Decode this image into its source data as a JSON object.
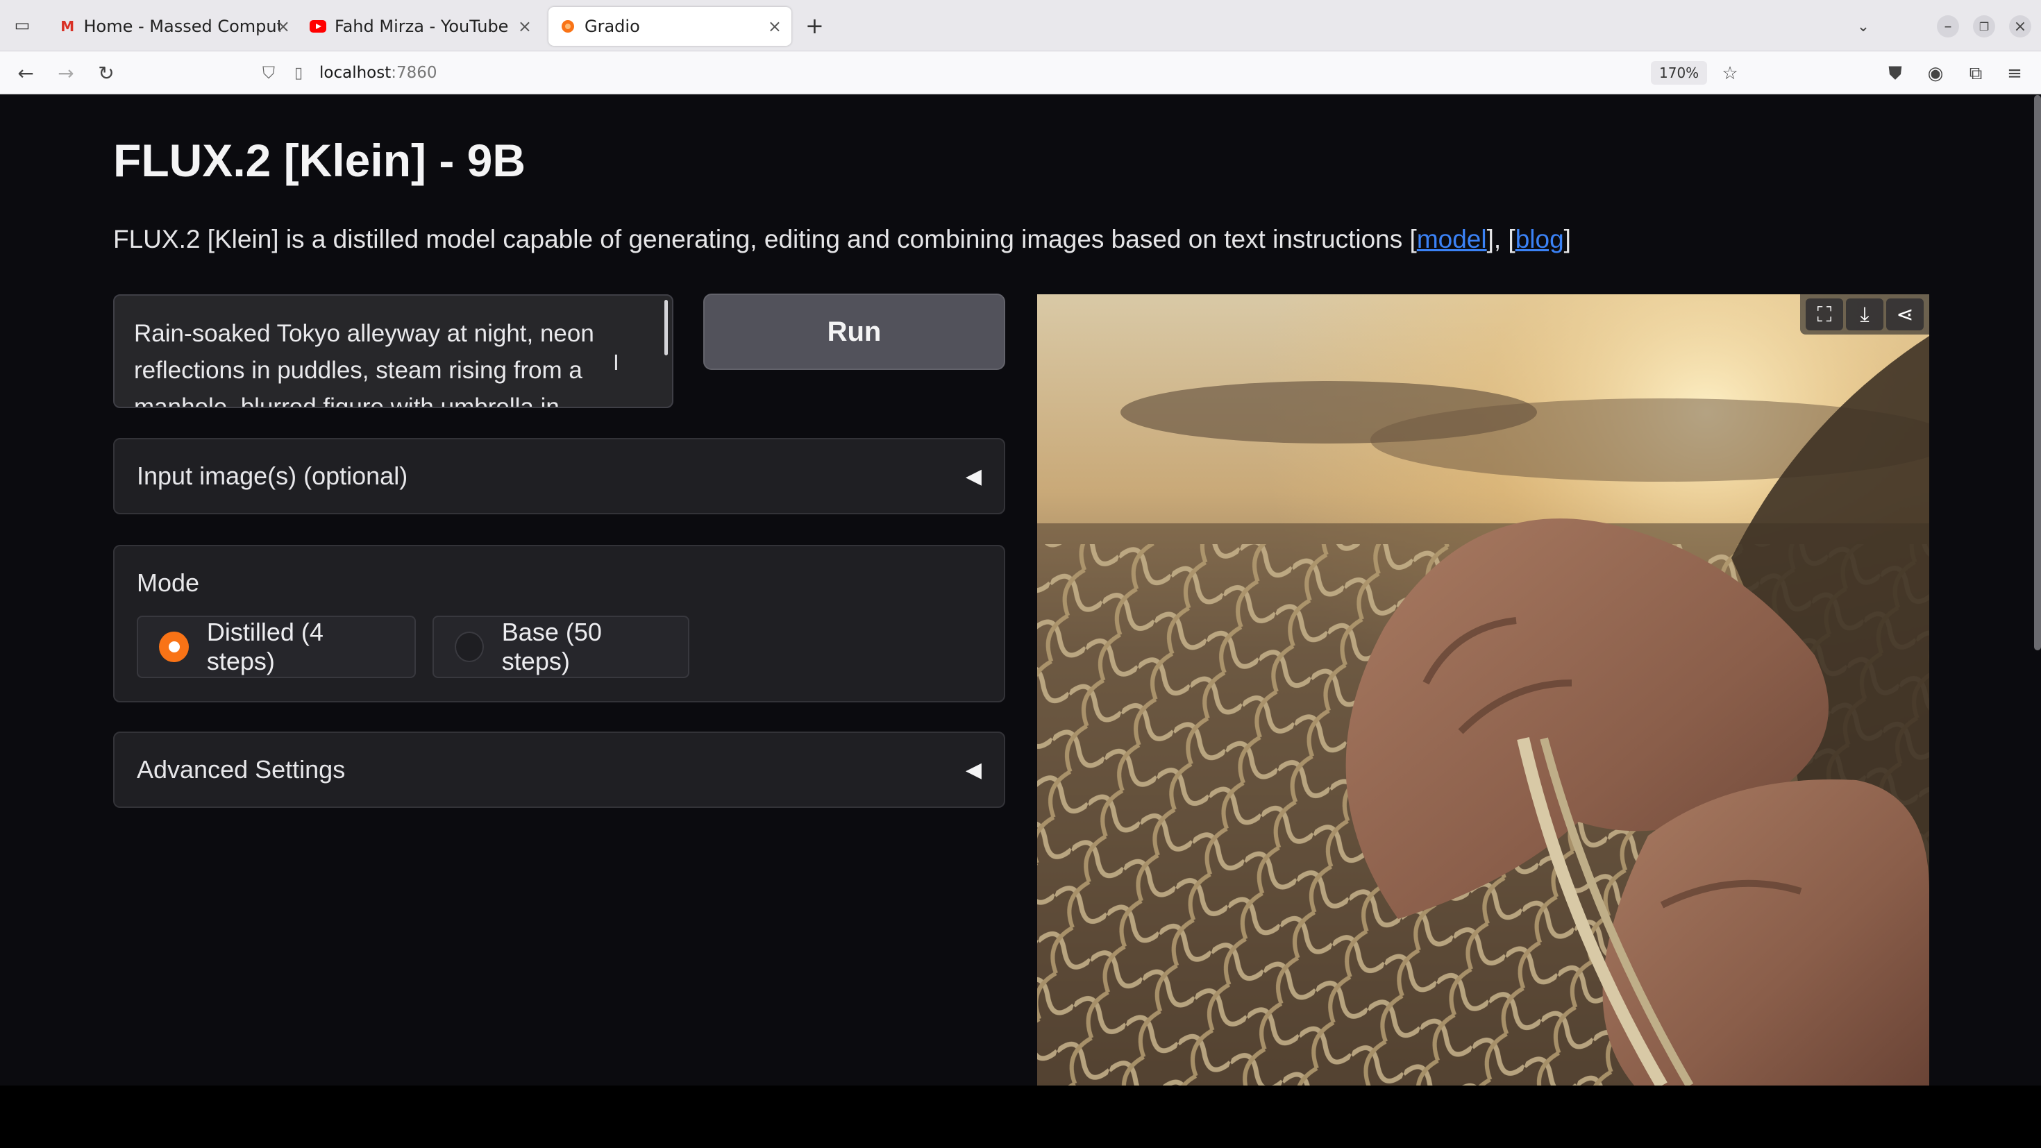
{
  "browser": {
    "tabs": [
      {
        "title": "Home - Massed Compute",
        "favicon": "gmail-m-icon",
        "active": false
      },
      {
        "title": "Fahd Mirza - YouTube",
        "favicon": "youtube-icon",
        "active": false
      },
      {
        "title": "Gradio",
        "favicon": "gradio-icon",
        "active": true
      }
    ],
    "url_host": "localhost",
    "url_port": ":7860",
    "zoom": "170%"
  },
  "app": {
    "title": "FLUX.2 [Klein] - 9B",
    "description_prefix": "FLUX.2 [Klein] is a distilled model capable of generating, editing and combining images based on text instructions [",
    "link_model": "model",
    "description_mid": "], [",
    "link_blog": "blog",
    "description_suffix": "]",
    "prompt_value": "Rain-soaked Tokyo alleyway at night, neon reflections in puddles, steam rising from a manhole, blurred figure with umbrella in",
    "run_label": "Run",
    "input_images_label": "Input image(s) (optional)",
    "mode": {
      "label": "Mode",
      "options": [
        {
          "label": "Distilled (4 steps)",
          "selected": true
        },
        {
          "label": "Base (50 steps)",
          "selected": false
        }
      ]
    },
    "advanced_label": "Advanced Settings",
    "output_image": {
      "subject": "weathered hands mending a fishing net at sunset",
      "tools": [
        "fullscreen-icon",
        "download-icon",
        "share-icon"
      ]
    }
  },
  "colors": {
    "accent": "#f97316",
    "page_bg": "#0b0b0f",
    "panel_bg": "#1f1f23",
    "link": "#3b82f6"
  }
}
